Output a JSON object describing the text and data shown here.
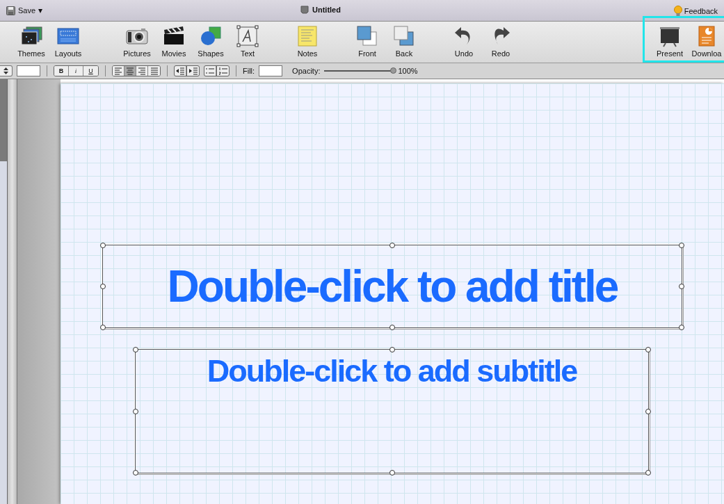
{
  "title_bar": {
    "save": "Save",
    "caret": "▾",
    "title": "Untitled",
    "feedback": "Feedback"
  },
  "toolbar": {
    "groups": [
      [
        {
          "label": "Themes"
        },
        {
          "label": "Layouts"
        }
      ],
      [
        {
          "label": "Pictures"
        },
        {
          "label": "Movies"
        },
        {
          "label": "Shapes"
        },
        {
          "label": "Text"
        }
      ],
      [
        {
          "label": "Notes"
        }
      ],
      [
        {
          "label": "Front"
        },
        {
          "label": "Back"
        }
      ],
      [
        {
          "label": "Undo"
        },
        {
          "label": "Redo"
        }
      ],
      [
        {
          "label": "Present"
        },
        {
          "label": "Downloa"
        }
      ]
    ]
  },
  "format_bar": {
    "style_buttons": [
      {
        "label": "B",
        "kind": "bold"
      },
      {
        "label": "i",
        "kind": "italic"
      },
      {
        "label": "U",
        "kind": "underline"
      }
    ],
    "align_buttons": [
      {
        "selected": false
      },
      {
        "selected": true
      },
      {
        "selected": false
      },
      {
        "selected": false
      }
    ],
    "fill_label": "Fill:",
    "opacity_label": "Opacity:",
    "opacity": {
      "level": 1.0
    },
    "opacity_reading": "100%"
  },
  "slide": {
    "title": "Double-click to add title",
    "subtitle": "Double-click to add subtitle"
  }
}
